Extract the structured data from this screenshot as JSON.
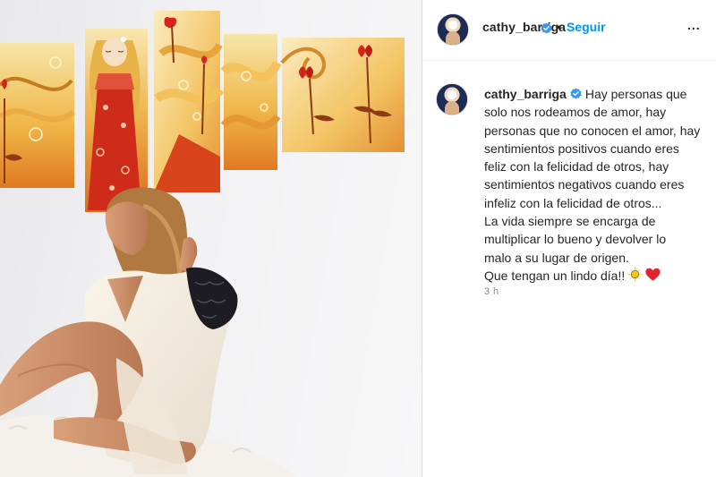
{
  "post": {
    "username": "cathy_barriga",
    "verified": true,
    "follow_label": "Seguir",
    "separator": "•",
    "more_label": "...",
    "caption_lines": [
      "Hay personas que",
      "solo nos rodeamos de amor, hay",
      "personas que no conocen el amor, hay",
      "sentimientos positivos cuando eres",
      "feliz con la felicidad de otros, hay",
      "sentimientos negativos cuando eres",
      "infeliz con la felicidad de otros...",
      "La vida siempre se encarga de",
      "multiplicar lo bueno y devolver lo",
      "malo a su lugar de origen.",
      "Que tengan un lindo día!!"
    ],
    "caption_emojis": [
      "sun-emoji",
      "red-heart-emoji"
    ],
    "timestamp": "3 h"
  },
  "colors": {
    "link_blue": "#0095f6",
    "verified_blue": "#3897f0",
    "text": "#262626",
    "muted": "#8e8e8e"
  }
}
